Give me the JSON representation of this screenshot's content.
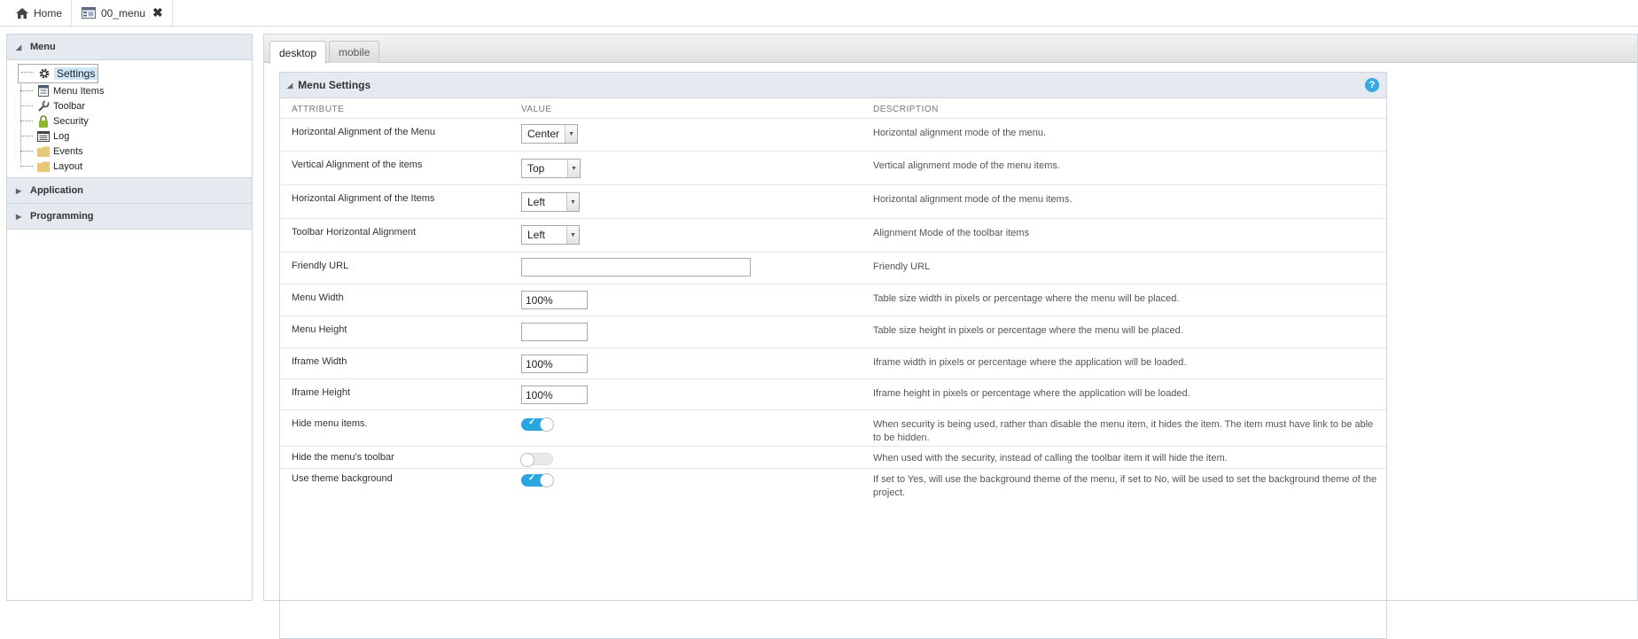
{
  "topbar": {
    "tabs": [
      {
        "label": "Home",
        "icon": "home-icon"
      },
      {
        "label": "00_menu",
        "icon": "menu-app-icon",
        "close": "✖"
      }
    ]
  },
  "sidebar": {
    "sections": [
      {
        "title": "Menu",
        "expanded": true,
        "items": [
          {
            "label": "Settings",
            "icon": "gear-icon",
            "selected": true
          },
          {
            "label": "Menu Items",
            "icon": "menu-items-icon"
          },
          {
            "label": "Toolbar",
            "icon": "wrench-icon"
          },
          {
            "label": "Security",
            "icon": "lock-icon"
          },
          {
            "label": "Log",
            "icon": "log-icon"
          },
          {
            "label": "Events",
            "icon": "folder-icon"
          },
          {
            "label": "Layout",
            "icon": "folder-icon"
          }
        ]
      },
      {
        "title": "Application",
        "expanded": false
      },
      {
        "title": "Programming",
        "expanded": false
      }
    ]
  },
  "main": {
    "tabs": [
      {
        "label": "desktop",
        "active": true
      },
      {
        "label": "mobile",
        "active": false
      }
    ],
    "section_title": "Menu Settings",
    "help_label": "?",
    "columns": {
      "attribute": "ATTRIBUTE",
      "value": "VALUE",
      "description": "DESCRIPTION"
    },
    "rows": [
      {
        "attribute": "Horizontal Alignment of the Menu",
        "type": "select",
        "value": "Center",
        "description": "Horizontal alignment mode of the menu."
      },
      {
        "attribute": "Vertical Alignment of the items",
        "type": "select",
        "value": "Top",
        "description": "Vertical alignment mode of the menu items."
      },
      {
        "attribute": "Horizontal Alignment of the Items",
        "type": "select",
        "value": "Left",
        "description": "Horizontal alignment mode of the menu items."
      },
      {
        "attribute": "Toolbar Horizontal Alignment",
        "type": "select",
        "value": "Left",
        "description": "Alignment Mode of the toolbar items"
      },
      {
        "attribute": "Friendly URL",
        "type": "input",
        "value": "",
        "description": "Friendly URL"
      },
      {
        "attribute": "Menu Width",
        "type": "input",
        "value": "100%",
        "description": "Table size width in pixels or percentage where the menu will be placed."
      },
      {
        "attribute": "Menu Height",
        "type": "input",
        "value": "",
        "description": "Table size height in pixels or percentage where the menu will be placed."
      },
      {
        "attribute": "Iframe Width",
        "type": "input",
        "value": "100%",
        "description": "Iframe width in pixels or percentage where the application will be loaded."
      },
      {
        "attribute": "Iframe Height",
        "type": "input",
        "value": "100%",
        "description": "Iframe height in pixels or percentage where the application will be loaded."
      },
      {
        "attribute": "Hide menu items.",
        "type": "toggle",
        "value": true,
        "description": "When security is being used, rather than disable the menu item, it hides the item. The item must have link to be able to be hidden."
      },
      {
        "attribute": "Hide the menu's toolbar",
        "type": "toggle",
        "value": false,
        "description": "When used with the security, instead of calling the toolbar item it will hide the item."
      },
      {
        "attribute": "Use theme background",
        "type": "toggle",
        "value": true,
        "description": "If set to Yes, will use the background theme of the menu, if set to No, will be used to set the background theme of the project."
      }
    ]
  },
  "colors": {
    "accent": "#29a5e0",
    "header_bg": "#e5eaf1",
    "border": "#cdd5df"
  }
}
